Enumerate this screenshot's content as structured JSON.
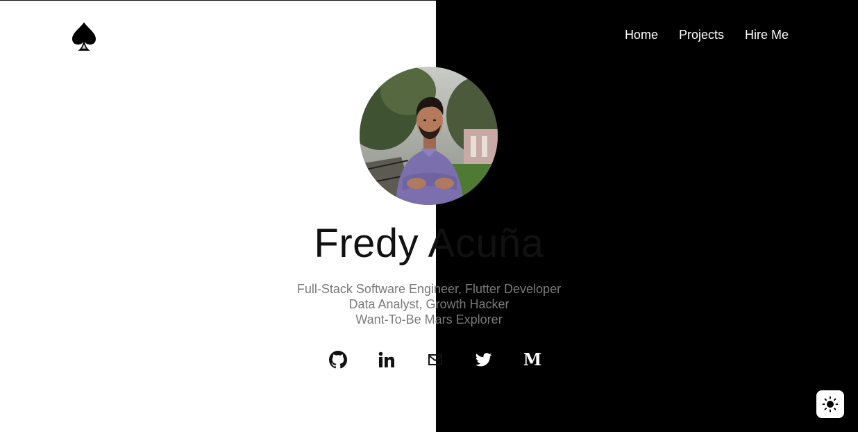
{
  "brand": {
    "logo_icon": "spade-icon"
  },
  "nav": {
    "items": [
      {
        "label": "Home"
      },
      {
        "label": "Projects"
      },
      {
        "label": "Hire Me"
      }
    ]
  },
  "hero": {
    "name": "Fredy Acuña",
    "roles": [
      "Full-Stack Software Engineer, Flutter Developer",
      "Data Analyst, Growth Hacker",
      "Want-To-Be Mars Explorer"
    ]
  },
  "socials": [
    {
      "icon": "github-icon"
    },
    {
      "icon": "linkedin-icon"
    },
    {
      "icon": "email-icon"
    },
    {
      "icon": "twitter-icon"
    },
    {
      "icon": "medium-icon"
    }
  ],
  "theme_toggle": {
    "icon": "sun-icon"
  },
  "colors": {
    "light_bg": "#ffffff",
    "dark_bg": "#000000",
    "name_text": "#111111",
    "role_text": "#7a7a7a"
  }
}
